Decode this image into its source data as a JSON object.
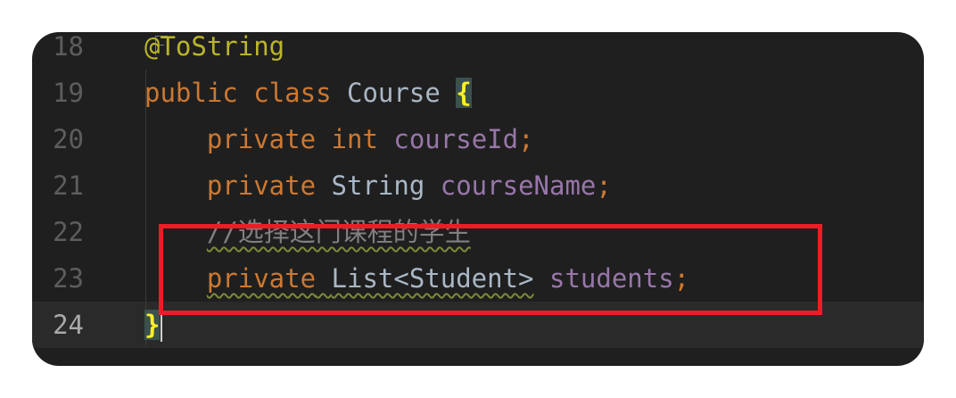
{
  "editor": {
    "lines": [
      {
        "number": "18",
        "tokens": [
          {
            "t": "@ToString",
            "c": "anno"
          }
        ]
      },
      {
        "number": "19",
        "tokens": [
          {
            "t": "public",
            "c": "kw"
          },
          {
            "t": " "
          },
          {
            "t": "class",
            "c": "kw"
          },
          {
            "t": " "
          },
          {
            "t": "Course",
            "c": "cls"
          },
          {
            "t": " "
          },
          {
            "t": "{",
            "c": "brace"
          }
        ]
      },
      {
        "number": "20",
        "tokens": [
          {
            "t": "    "
          },
          {
            "t": "private",
            "c": "kw"
          },
          {
            "t": " "
          },
          {
            "t": "int",
            "c": "kw"
          },
          {
            "t": " "
          },
          {
            "t": "courseId",
            "c": "field"
          },
          {
            "t": ";",
            "c": "punct"
          }
        ]
      },
      {
        "number": "21",
        "tokens": [
          {
            "t": "    "
          },
          {
            "t": "private",
            "c": "kw"
          },
          {
            "t": " "
          },
          {
            "t": "String",
            "c": "cls"
          },
          {
            "t": " "
          },
          {
            "t": "courseName",
            "c": "field"
          },
          {
            "t": ";",
            "c": "punct"
          }
        ]
      },
      {
        "number": "22",
        "tokens": [
          {
            "t": "    "
          },
          {
            "t": "//选择这门课程的学生",
            "c": "comment squiggle"
          }
        ]
      },
      {
        "number": "23",
        "tokens": [
          {
            "t": "    "
          },
          {
            "t": "private List<Student>",
            "c": "kw-mixed squiggle"
          },
          {
            "t": " "
          },
          {
            "t": "students",
            "c": "field"
          },
          {
            "t": ";",
            "c": "punct"
          }
        ]
      },
      {
        "number": "24",
        "current": true,
        "tokens": [
          {
            "t": "}",
            "c": "brace"
          }
        ]
      }
    ]
  },
  "colors": {
    "keyword": "#cc7832",
    "annotation": "#bbb529",
    "field": "#9876aa",
    "class": "#a9b7c6",
    "comment": "#808080",
    "highlight": "#ee1c25"
  }
}
